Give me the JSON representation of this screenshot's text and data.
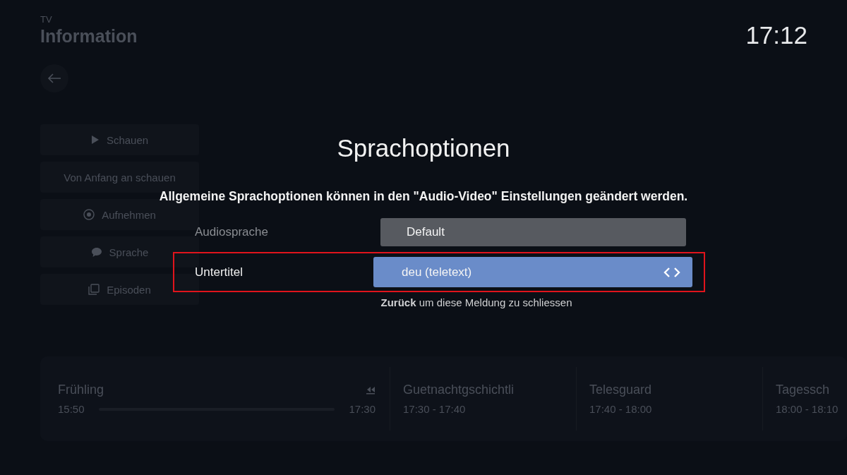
{
  "clock": "17:12",
  "page": {
    "section": "TV",
    "title": "Information"
  },
  "sidebar": {
    "items": [
      {
        "label": "Schauen",
        "kind": "play"
      },
      {
        "label": "Von Anfang an schauen",
        "kind": "text"
      },
      {
        "label": "Aufnehmen",
        "kind": "record"
      },
      {
        "label": "Sprache",
        "kind": "speech"
      },
      {
        "label": "Episoden",
        "kind": "episodes"
      }
    ]
  },
  "programs": [
    {
      "title": "Frühling",
      "start": "15:50",
      "end": "17:30",
      "kind": "progress"
    },
    {
      "title": "Guetnachtgschichtli",
      "time": "17:30 - 17:40",
      "kind": "slot"
    },
    {
      "title": "Telesguard",
      "time": "17:40 - 18:00",
      "kind": "slot"
    },
    {
      "title": "Tagessch",
      "time": "18:00 - 18:10",
      "kind": "slot"
    }
  ],
  "dialog": {
    "title": "Sprachoptionen",
    "message": "Allgemeine Sprachoptionen können in den \"Audio-Video\" Einstellungen geändert werden.",
    "rows": [
      {
        "label": "Audiosprache",
        "value": "Default",
        "selected": false
      },
      {
        "label": "Untertitel",
        "value": "deu (teletext)",
        "selected": true
      }
    ],
    "hint": "**Zurück** um diese Meldung zu schliessen"
  }
}
